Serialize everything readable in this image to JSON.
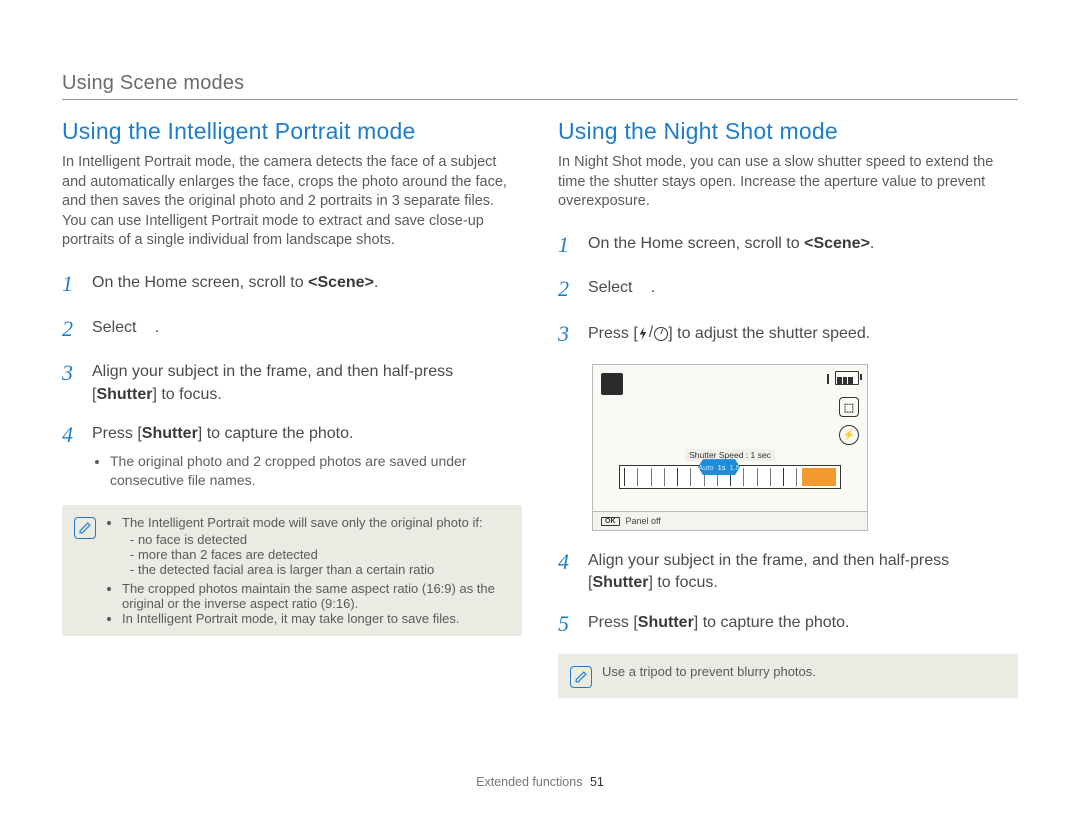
{
  "section_header": "Using Scene modes",
  "left": {
    "title": "Using the Intelligent Portrait mode",
    "intro": "In Intelligent Portrait mode, the camera detects the face of a subject and automatically enlarges the face, crops the photo around the face, and then saves the original photo and 2 portraits in 3 separate files. You can use Intelligent Portrait mode to extract and save close-up portraits of a single individual from landscape shots.",
    "steps": [
      {
        "n": "1",
        "pre": "On the Home screen, scroll to ",
        "bold": "<Scene>",
        "post": "."
      },
      {
        "n": "2",
        "pre": "Select ",
        "select_icon": true,
        "post": "."
      },
      {
        "n": "3",
        "pre": "Align your subject in the frame, and then half-press [",
        "bold": "Shutter",
        "post": "] to focus."
      },
      {
        "n": "4",
        "pre": "Press [",
        "bold": "Shutter",
        "post": "] to capture the photo.",
        "sub": "The original photo and 2 cropped photos are saved under consecutive file names."
      }
    ],
    "note": {
      "bullets": [
        {
          "text": "The Intelligent Portrait mode will save only the original photo if:",
          "sub": [
            "no face is detected",
            "more than 2 faces are detected",
            "the detected facial area is larger than a certain ratio"
          ]
        },
        {
          "text": "The cropped photos maintain the same aspect ratio (16:9) as the original or the inverse aspect ratio (9:16)."
        },
        {
          "text": "In Intelligent Portrait mode, it may take longer to save files."
        }
      ]
    }
  },
  "right": {
    "title": "Using the Night Shot mode",
    "intro": "In Night Shot mode, you can use a slow shutter speed to extend the time the shutter stays open. Increase the aperture value to prevent overexposure.",
    "steps": [
      {
        "n": "1",
        "pre": "On the Home screen, scroll to ",
        "bold": "<Scene>",
        "post": "."
      },
      {
        "n": "2",
        "pre": "Select ",
        "select_icon": true,
        "post": "."
      },
      {
        "n": "3",
        "pre": "Press [",
        "icons": true,
        "post": "] to adjust the shutter speed."
      },
      {
        "n": "4",
        "pre": "Align your subject in the frame, and then half-press [",
        "bold": "Shutter",
        "post": "] to focus."
      },
      {
        "n": "5",
        "pre": "Press [",
        "bold": "Shutter",
        "post": "] to capture the photo."
      }
    ],
    "lcd": {
      "shutter_label": "Shutter Speed : 1 sec",
      "pointer_labels": [
        "Auto",
        "1s",
        "1.5"
      ],
      "footer_ok": "OK",
      "footer_text": "Panel off"
    },
    "note_text": "Use a tripod to prevent blurry photos."
  },
  "footer": {
    "label": "Extended functions",
    "page": "51"
  }
}
